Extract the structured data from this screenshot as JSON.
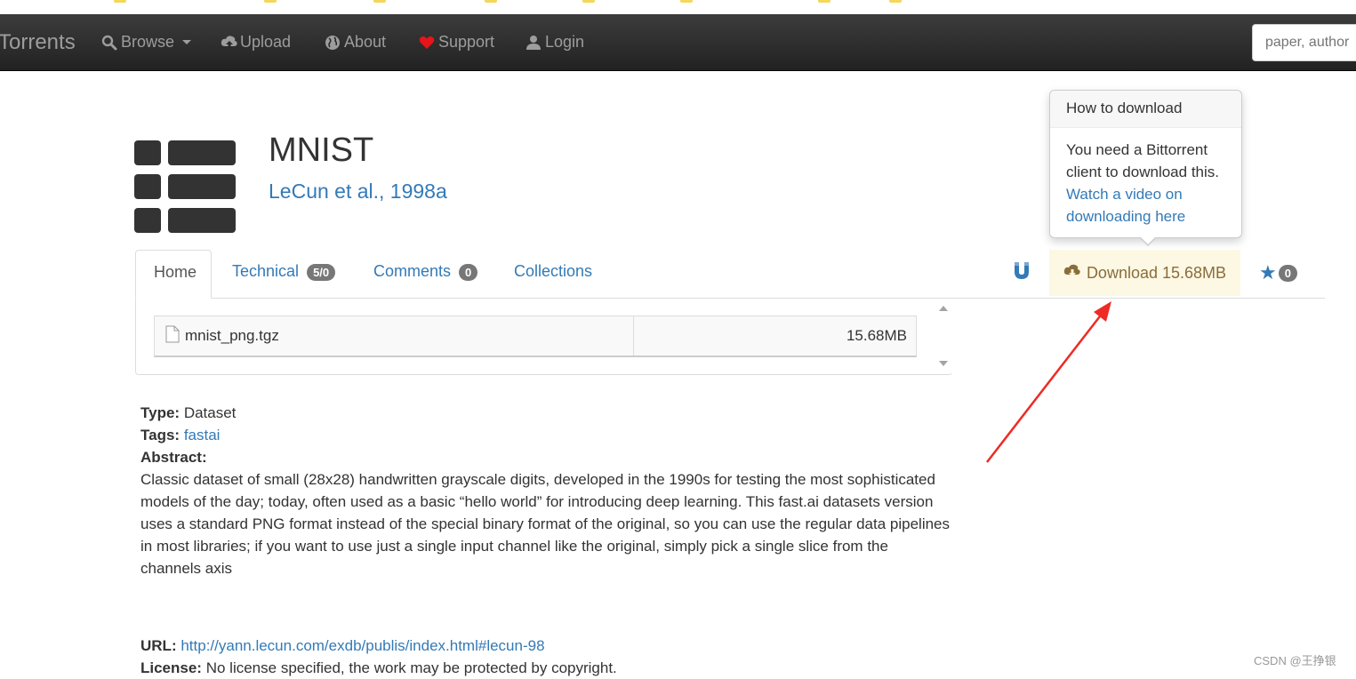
{
  "navbar": {
    "brand": "Torrents",
    "items": [
      {
        "label": "Browse",
        "icon": "search-icon"
      },
      {
        "label": "Upload",
        "icon": "cloud-upload-icon"
      },
      {
        "label": "About",
        "icon": "globe-icon"
      },
      {
        "label": "Support",
        "icon": "heart-icon"
      },
      {
        "label": "Login",
        "icon": "user-icon"
      }
    ],
    "search_placeholder": "paper, author"
  },
  "header": {
    "title": "MNIST",
    "author": "LeCun et al., 1998a"
  },
  "tabs": [
    {
      "label": "Home",
      "badge": ""
    },
    {
      "label": "Technical",
      "badge": "5/0"
    },
    {
      "label": "Comments",
      "badge": "0"
    },
    {
      "label": "Collections",
      "badge": ""
    }
  ],
  "actions": {
    "download_label": "Download 15.68MB",
    "star_count": "0",
    "download_color": "#fcf8e3",
    "link_color": "#337ab7"
  },
  "popover": {
    "title": "How to download",
    "body_text": "You need a Bittorrent client to download this.",
    "link_text": "Watch a video on downloading here"
  },
  "files": [
    {
      "name": "mnist_png.tgz",
      "size": "15.68MB"
    }
  ],
  "details": {
    "type_label": "Type:",
    "type_value": "Dataset",
    "tags_label": "Tags:",
    "tags_value": "fastai",
    "abstract_label": "Abstract:",
    "abstract_text": "Classic dataset of small (28x28) handwritten grayscale digits, developed in the 1990s for testing the most sophisticated models of the day; today, often used as a basic “hello world” for introducing deep learning. This fast.ai datasets version uses a standard PNG format instead of the special binary format of the original, so you can use the regular data pipelines in most libraries; if you want to use just a single input channel like the original, simply pick a single slice from the channels axis",
    "url_label": "URL:",
    "url_value": "http://yann.lecun.com/exdb/publis/index.html#lecun-98",
    "license_label": "License:",
    "license_value": "No license specified, the work may be protected by copyright."
  },
  "watermark": "CSDN @王挣银"
}
